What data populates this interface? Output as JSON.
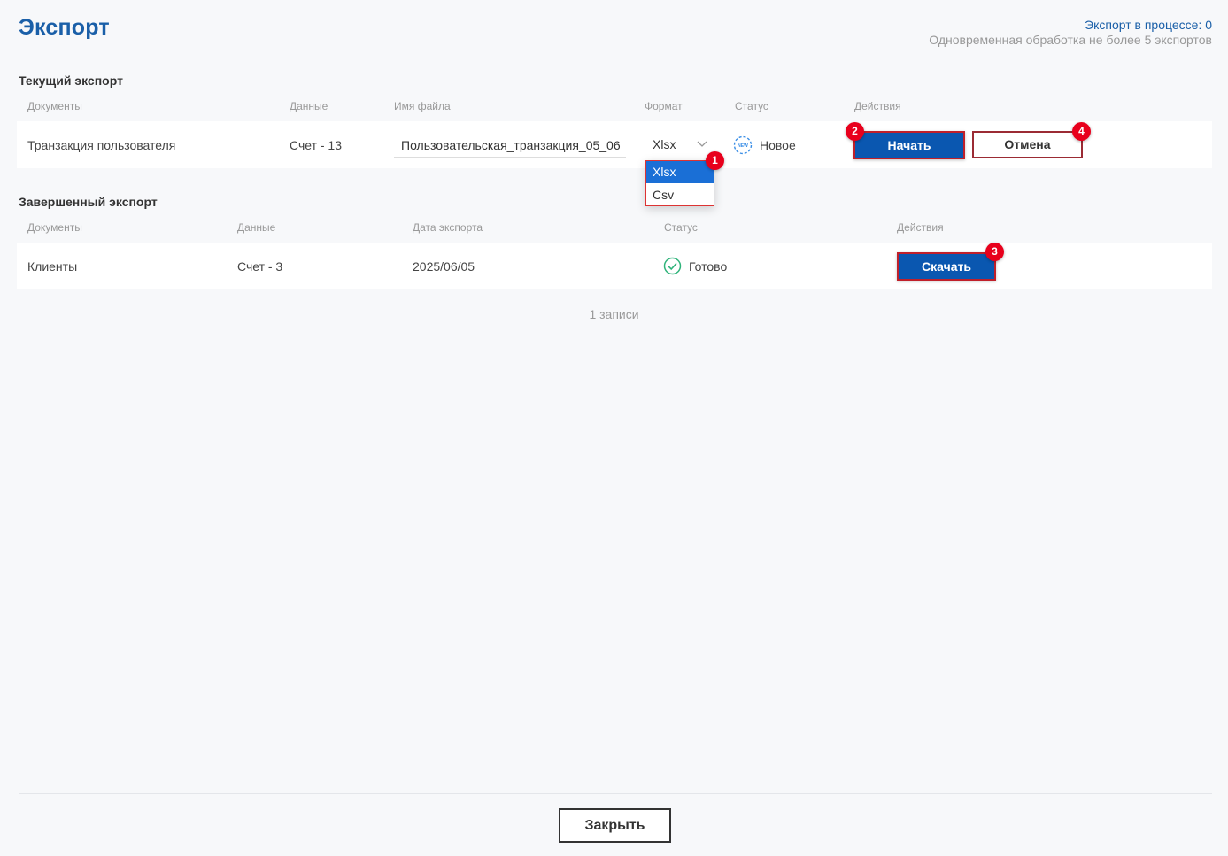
{
  "header": {
    "title": "Экспорт",
    "export_in_progress": "Экспорт в процессе: 0",
    "concurrency_note": "Одновременная обработка не более 5 экспортов"
  },
  "current_export": {
    "title": "Текущий экспорт",
    "columns": [
      "Документы",
      "Данные",
      "Имя файла",
      "Формат",
      "Статус",
      "Действия"
    ],
    "row": {
      "document": "Транзакция пользователя",
      "data": "Счет - 13",
      "filename": "Пользовательская_транзакция_05_06",
      "format": "Xlsx",
      "status_icon_text": "NEW",
      "status": "Новое",
      "start_button": "Начать",
      "cancel_button": "Отмена"
    },
    "format_options": [
      "Xlsx",
      "Csv"
    ]
  },
  "completed_export": {
    "title": "Завершенный экспорт",
    "columns": [
      "Документы",
      "Данные",
      "Дата экспорта",
      "Статус",
      "Действия"
    ],
    "rows": [
      {
        "document": "Клиенты",
        "data": "Счет - 3",
        "date": "2025/06/05",
        "status": "Готово",
        "download_button": "Скачать"
      }
    ],
    "records_count": "1 записи"
  },
  "badges": [
    "1",
    "2",
    "3",
    "4"
  ],
  "footer": {
    "close_button": "Закрыть"
  },
  "colors": {
    "accent": "#1a5fa8",
    "primary_button": "#0a57b0",
    "badge": "#e8001c",
    "success": "#2fb37a",
    "dropdown_selected": "#1a6fd6"
  }
}
